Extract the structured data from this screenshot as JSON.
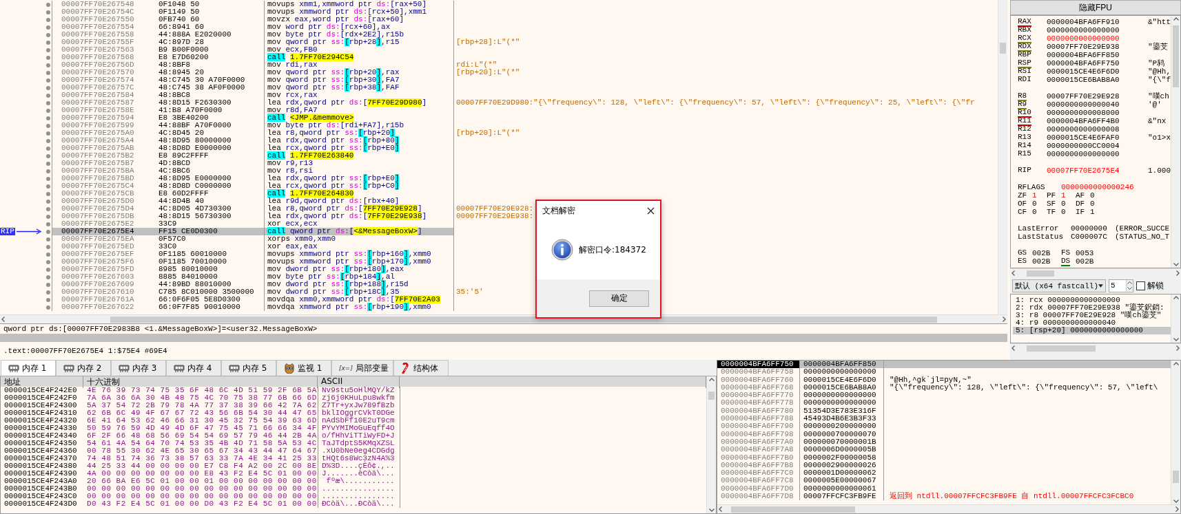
{
  "disassembly": {
    "rip_label": "RIP",
    "rows": [
      {
        "address": "00007FF70E267548",
        "bytes": "0F1048 50",
        "instruction": [
          {
            "text": "movups",
            "kind": "mnemonic"
          },
          {
            "text": " xmm1,xmmword ptr ",
            "kind": "operand"
          },
          {
            "text": "ds:",
            "kind": "segment"
          },
          {
            "text": "[rax+50]",
            "kind": "operand"
          }
        ],
        "current": false
      },
      {
        "address": "00007FF70E26754C",
        "bytes": "0F1149 50",
        "instruction": [
          {
            "text": "movups",
            "kind": "mnemonic"
          },
          {
            "text": " xmmword ptr ",
            "kind": "operand"
          },
          {
            "text": "ds:",
            "kind": "segment"
          },
          {
            "text": "[rcx+50],xmm1",
            "kind": "operand"
          }
        ],
        "current": false
      },
      {
        "address": "00007FF70E267550",
        "bytes": "0FB740 60",
        "instruction": [
          {
            "text": "movzx",
            "kind": "mnemonic"
          },
          {
            "text": " eax,word ptr ",
            "kind": "operand"
          },
          {
            "text": "ds:",
            "kind": "segment"
          },
          {
            "text": "[rax+60]",
            "kind": "operand"
          }
        ],
        "current": false
      },
      {
        "address": "00007FF70E267554",
        "bytes": "66:8941 60",
        "instruction": [
          {
            "text": "mov",
            "kind": "mnemonic"
          },
          {
            "text": " word ptr ",
            "kind": "operand"
          },
          {
            "text": "ds:",
            "kind": "segment"
          },
          {
            "text": "[rcx+60],ax",
            "kind": "operand"
          }
        ],
        "current": false
      },
      {
        "address": "00007FF70E267558",
        "bytes": "44:888A E2020000",
        "instruction": [
          {
            "text": "mov",
            "kind": "mnemonic"
          },
          {
            "text": " byte ptr ",
            "kind": "operand"
          },
          {
            "text": "ds:",
            "kind": "segment"
          },
          {
            "text": "[rdx+2E2],r15b",
            "kind": "operand"
          }
        ],
        "current": false
      },
      {
        "address": "00007FF70E26755F",
        "bytes": "4C:897D 28",
        "instruction": [
          {
            "text": "mov",
            "kind": "mnemonic"
          },
          {
            "text": " qword ptr ",
            "kind": "operand"
          },
          {
            "text": "ss:",
            "kind": "segment"
          },
          {
            "text": "[",
            "kind": "bracket"
          },
          {
            "text": "rbp+28",
            "kind": "operand"
          },
          {
            "text": "]",
            "kind": "bracket"
          },
          {
            "text": ",r15",
            "kind": "operand"
          }
        ],
        "comment": "[rbp+28]:L\"(*\"",
        "current": false
      },
      {
        "address": "00007FF70E267563",
        "bytes": "B9 B00F0000",
        "instruction": [
          {
            "text": "mov",
            "kind": "mnemonic"
          },
          {
            "text": " ecx,FB0",
            "kind": "operand"
          }
        ],
        "current": false
      },
      {
        "address": "00007FF70E267568",
        "bytes": "E8 E7D60200",
        "instruction": [
          {
            "text": "call",
            "kind": "call"
          },
          {
            "text": "1.7FF70E294C54",
            "kind": "target"
          }
        ],
        "current": false
      },
      {
        "address": "00007FF70E26756D",
        "bytes": "48:8BF8",
        "instruction": [
          {
            "text": "mov",
            "kind": "mnemonic"
          },
          {
            "text": " rdi,rax",
            "kind": "operand"
          }
        ],
        "comment": "rdi:L\"(*\"",
        "current": false
      },
      {
        "address": "00007FF70E267570",
        "bytes": "48:8945 20",
        "instruction": [
          {
            "text": "mov",
            "kind": "mnemonic"
          },
          {
            "text": " qword ptr ",
            "kind": "operand"
          },
          {
            "text": "ss:",
            "kind": "segment"
          },
          {
            "text": "[",
            "kind": "bracket"
          },
          {
            "text": "rbp+20",
            "kind": "operand"
          },
          {
            "text": "]",
            "kind": "bracket"
          },
          {
            "text": ",rax",
            "kind": "operand"
          }
        ],
        "comment": "[rbp+20]:L\"(*\"",
        "current": false
      },
      {
        "address": "00007FF70E267574",
        "bytes": "48:C745 30 A70F0000",
        "instruction": [
          {
            "text": "mov",
            "kind": "mnemonic"
          },
          {
            "text": " qword ptr ",
            "kind": "operand"
          },
          {
            "text": "ss:",
            "kind": "segment"
          },
          {
            "text": "[",
            "kind": "bracket"
          },
          {
            "text": "rbp+30",
            "kind": "operand"
          },
          {
            "text": "]",
            "kind": "bracket"
          },
          {
            "text": ",FA7",
            "kind": "operand"
          }
        ],
        "current": false
      },
      {
        "address": "00007FF70E26757C",
        "bytes": "48:C745 38 AF0F0000",
        "instruction": [
          {
            "text": "mov",
            "kind": "mnemonic"
          },
          {
            "text": " qword ptr ",
            "kind": "operand"
          },
          {
            "text": "ss:",
            "kind": "segment"
          },
          {
            "text": "[",
            "kind": "bracket"
          },
          {
            "text": "rbp+38",
            "kind": "operand"
          },
          {
            "text": "]",
            "kind": "bracket"
          },
          {
            "text": ",FAF",
            "kind": "operand"
          }
        ],
        "current": false
      },
      {
        "address": "00007FF70E267584",
        "bytes": "48:8BC8",
        "instruction": [
          {
            "text": "mov",
            "kind": "mnemonic"
          },
          {
            "text": " rcx,rax",
            "kind": "operand"
          }
        ],
        "current": false
      },
      {
        "address": "00007FF70E267587",
        "bytes": "48:8D15 F2630300",
        "instruction": [
          {
            "text": "lea",
            "kind": "mnemonic"
          },
          {
            "text": " rdx,qword ptr ",
            "kind": "operand"
          },
          {
            "text": "ds:",
            "kind": "segment"
          },
          {
            "text": "[",
            "kind": "operand"
          },
          {
            "text": "7FF70E29D980",
            "kind": "target"
          },
          {
            "text": "]",
            "kind": "operand"
          }
        ],
        "comment": "00007FF70E29D980:\"{\\\"frequency\\\": 128, \\\"left\\\": {\\\"frequency\\\": 57, \\\"left\\\": {\\\"frequency\\\": 25, \\\"left\\\": {\\\"fr",
        "current": false
      },
      {
        "address": "00007FF70E26758E",
        "bytes": "41:B8 A70F0000",
        "instruction": [
          {
            "text": "mov",
            "kind": "mnemonic"
          },
          {
            "text": " r8d,FA7",
            "kind": "operand"
          }
        ],
        "current": false
      },
      {
        "address": "00007FF70E267594",
        "bytes": "E8 3BE40200",
        "instruction": [
          {
            "text": "call",
            "kind": "call"
          },
          {
            "text": "<JMP.&memmove>",
            "kind": "target"
          }
        ],
        "current": false
      },
      {
        "address": "00007FF70E267599",
        "bytes": "44:88BF A70F0000",
        "instruction": [
          {
            "text": "mov",
            "kind": "mnemonic"
          },
          {
            "text": " byte ptr ",
            "kind": "operand"
          },
          {
            "text": "ds:",
            "kind": "segment"
          },
          {
            "text": "[rdi+FA7],r15b",
            "kind": "operand"
          }
        ],
        "current": false
      },
      {
        "address": "00007FF70E2675A0",
        "bytes": "4C:8D45 20",
        "instruction": [
          {
            "text": "lea",
            "kind": "mnemonic"
          },
          {
            "text": " r8,qword ptr ",
            "kind": "operand"
          },
          {
            "text": "ss:",
            "kind": "segment"
          },
          {
            "text": "[",
            "kind": "bracket"
          },
          {
            "text": "rbp+20",
            "kind": "operand"
          },
          {
            "text": "]",
            "kind": "bracket"
          }
        ],
        "comment": "[rbp+20]:L\"(*\"",
        "current": false
      },
      {
        "address": "00007FF70E2675A4",
        "bytes": "48:8D95 80000000",
        "instruction": [
          {
            "text": "lea",
            "kind": "mnemonic"
          },
          {
            "text": " rdx,qword ptr ",
            "kind": "operand"
          },
          {
            "text": "ss:",
            "kind": "segment"
          },
          {
            "text": "[",
            "kind": "bracket"
          },
          {
            "text": "rbp+80",
            "kind": "operand"
          },
          {
            "text": "]",
            "kind": "bracket"
          }
        ],
        "current": false
      },
      {
        "address": "00007FF70E2675AB",
        "bytes": "48:8D8D E0000000",
        "instruction": [
          {
            "text": "lea",
            "kind": "mnemonic"
          },
          {
            "text": " rcx,qword ptr ",
            "kind": "operand"
          },
          {
            "text": "ss:",
            "kind": "segment"
          },
          {
            "text": "[",
            "kind": "bracket"
          },
          {
            "text": "rbp+E0",
            "kind": "operand"
          },
          {
            "text": "]",
            "kind": "bracket"
          }
        ],
        "current": false
      },
      {
        "address": "00007FF70E2675B2",
        "bytes": "E8 89C2FFFF",
        "instruction": [
          {
            "text": "call",
            "kind": "call"
          },
          {
            "text": "1.7FF70E263840",
            "kind": "target"
          }
        ],
        "current": false
      },
      {
        "address": "00007FF70E2675B7",
        "bytes": "4D:8BCD",
        "instruction": [
          {
            "text": "mov",
            "kind": "mnemonic"
          },
          {
            "text": " r9,r13",
            "kind": "operand"
          }
        ],
        "current": false
      },
      {
        "address": "00007FF70E2675BA",
        "bytes": "4C:8BC6",
        "instruction": [
          {
            "text": "mov",
            "kind": "mnemonic"
          },
          {
            "text": " r8,rsi",
            "kind": "operand"
          }
        ],
        "current": false
      },
      {
        "address": "00007FF70E2675BD",
        "bytes": "48:8D95 E0000000",
        "instruction": [
          {
            "text": "lea",
            "kind": "mnemonic"
          },
          {
            "text": " rdx,qword ptr ",
            "kind": "operand"
          },
          {
            "text": "ss:",
            "kind": "segment"
          },
          {
            "text": "[",
            "kind": "bracket"
          },
          {
            "text": "rbp+E0",
            "kind": "operand"
          },
          {
            "text": "]",
            "kind": "bracket"
          }
        ],
        "current": false
      },
      {
        "address": "00007FF70E2675C4",
        "bytes": "48:8D8D C0000000",
        "instruction": [
          {
            "text": "lea",
            "kind": "mnemonic"
          },
          {
            "text": " rcx,qword ptr ",
            "kind": "operand"
          },
          {
            "text": "ss:",
            "kind": "segment"
          },
          {
            "text": "[",
            "kind": "bracket"
          },
          {
            "text": "rbp+C0",
            "kind": "operand"
          },
          {
            "text": "]",
            "kind": "bracket"
          }
        ],
        "current": false
      },
      {
        "address": "00007FF70E2675CB",
        "bytes": "E8 60D2FFFF",
        "instruction": [
          {
            "text": "call",
            "kind": "call"
          },
          {
            "text": "1.7FF70E264830",
            "kind": "target"
          }
        ],
        "current": false
      },
      {
        "address": "00007FF70E2675D0",
        "bytes": "44:8D4B 40",
        "instruction": [
          {
            "text": "lea",
            "kind": "mnemonic"
          },
          {
            "text": " r9d,qword ptr ",
            "kind": "operand"
          },
          {
            "text": "ds:",
            "kind": "segment"
          },
          {
            "text": "[rbx+40]",
            "kind": "operand"
          }
        ],
        "current": false
      },
      {
        "address": "00007FF70E2675D4",
        "bytes": "4C:8D05 4D730300",
        "instruction": [
          {
            "text": "lea",
            "kind": "mnemonic"
          },
          {
            "text": " r8,qword ptr ",
            "kind": "operand"
          },
          {
            "text": "ds:",
            "kind": "segment"
          },
          {
            "text": "[",
            "kind": "operand"
          },
          {
            "text": "7FF70E29E928",
            "kind": "target"
          },
          {
            "text": "]",
            "kind": "operand"
          }
        ],
        "comment": "00007FF70E29E928:",
        "current": false
      },
      {
        "address": "00007FF70E2675DB",
        "bytes": "48:8D15 56730300",
        "instruction": [
          {
            "text": "lea",
            "kind": "mnemonic"
          },
          {
            "text": " rdx,qword ptr ",
            "kind": "operand"
          },
          {
            "text": "ds:",
            "kind": "segment"
          },
          {
            "text": "[",
            "kind": "operand"
          },
          {
            "text": "7FF70E29E938",
            "kind": "target"
          },
          {
            "text": "]",
            "kind": "operand"
          }
        ],
        "comment": "00007FF70E29E938:",
        "current": false
      },
      {
        "address": "00007FF70E2675E2",
        "bytes": "33C9",
        "instruction": [
          {
            "text": "xor",
            "kind": "mnemonic"
          },
          {
            "text": " ecx,ecx",
            "kind": "operand"
          }
        ],
        "current": false
      },
      {
        "address": "00007FF70E2675E4",
        "bytes": "FF15 CE0D0300",
        "instruction": [
          {
            "text": "call",
            "kind": "call"
          },
          {
            "text": " qword ptr ",
            "kind": "operand"
          },
          {
            "text": "ds:",
            "kind": "segment"
          },
          {
            "text": "[",
            "kind": "operand"
          },
          {
            "text": "<&MessageBoxW>",
            "kind": "target"
          },
          {
            "text": "]",
            "kind": "operand"
          }
        ],
        "current": true
      },
      {
        "address": "00007FF70E2675EA",
        "bytes": "0F57C0",
        "instruction": [
          {
            "text": "xorps",
            "kind": "mnemonic"
          },
          {
            "text": " xmm0,xmm0",
            "kind": "operand"
          }
        ],
        "current": false
      },
      {
        "address": "00007FF70E2675ED",
        "bytes": "33C0",
        "instruction": [
          {
            "text": "xor",
            "kind": "mnemonic"
          },
          {
            "text": " eax,eax",
            "kind": "operand"
          }
        ],
        "current": false
      },
      {
        "address": "00007FF70E2675EF",
        "bytes": "0F1185 60010000",
        "instruction": [
          {
            "text": "movups",
            "kind": "mnemonic"
          },
          {
            "text": " xmmword ptr ",
            "kind": "operand"
          },
          {
            "text": "ss:",
            "kind": "segment"
          },
          {
            "text": "[",
            "kind": "bracket"
          },
          {
            "text": "rbp+160",
            "kind": "operand"
          },
          {
            "text": "]",
            "kind": "bracket"
          },
          {
            "text": ",xmm0",
            "kind": "operand"
          }
        ],
        "current": false
      },
      {
        "address": "00007FF70E2675F6",
        "bytes": "0F1185 70010000",
        "instruction": [
          {
            "text": "movups",
            "kind": "mnemonic"
          },
          {
            "text": " xmmword ptr ",
            "kind": "operand"
          },
          {
            "text": "ss:",
            "kind": "segment"
          },
          {
            "text": "[",
            "kind": "bracket"
          },
          {
            "text": "rbp+170",
            "kind": "operand"
          },
          {
            "text": "]",
            "kind": "bracket"
          },
          {
            "text": ",xmm0",
            "kind": "operand"
          }
        ],
        "current": false
      },
      {
        "address": "00007FF70E2675FD",
        "bytes": "8985 80010000",
        "instruction": [
          {
            "text": "mov",
            "kind": "mnemonic"
          },
          {
            "text": " dword ptr ",
            "kind": "operand"
          },
          {
            "text": "ss:",
            "kind": "segment"
          },
          {
            "text": "[",
            "kind": "bracket"
          },
          {
            "text": "rbp+180",
            "kind": "operand"
          },
          {
            "text": "]",
            "kind": "bracket"
          },
          {
            "text": ",eax",
            "kind": "operand"
          }
        ],
        "current": false
      },
      {
        "address": "00007FF70E267603",
        "bytes": "8885 84010000",
        "instruction": [
          {
            "text": "mov",
            "kind": "mnemonic"
          },
          {
            "text": " byte ptr ",
            "kind": "operand"
          },
          {
            "text": "ss:",
            "kind": "segment"
          },
          {
            "text": "[",
            "kind": "bracket"
          },
          {
            "text": "rbp+184",
            "kind": "operand"
          },
          {
            "text": "]",
            "kind": "bracket"
          },
          {
            "text": ",al",
            "kind": "operand"
          }
        ],
        "current": false
      },
      {
        "address": "00007FF70E267609",
        "bytes": "44:89BD 88010000",
        "instruction": [
          {
            "text": "mov",
            "kind": "mnemonic"
          },
          {
            "text": " dword ptr ",
            "kind": "operand"
          },
          {
            "text": "ss:",
            "kind": "segment"
          },
          {
            "text": "[",
            "kind": "bracket"
          },
          {
            "text": "rbp+188",
            "kind": "operand"
          },
          {
            "text": "]",
            "kind": "bracket"
          },
          {
            "text": ",r15d",
            "kind": "operand"
          }
        ],
        "current": false
      },
      {
        "address": "00007FF70E267610",
        "bytes": "C785 8C010000 3500000",
        "instruction": [
          {
            "text": "mov",
            "kind": "mnemonic"
          },
          {
            "text": " dword ptr ",
            "kind": "operand"
          },
          {
            "text": "ss:",
            "kind": "segment"
          },
          {
            "text": "[",
            "kind": "bracket"
          },
          {
            "text": "rbp+18C",
            "kind": "operand"
          },
          {
            "text": "]",
            "kind": "bracket"
          },
          {
            "text": ",35",
            "kind": "operand"
          }
        ],
        "comment": "35:'5'",
        "current": false
      },
      {
        "address": "00007FF70E26761A",
        "bytes": "66:0F6F05 5E8D0300",
        "instruction": [
          {
            "text": "movdqa",
            "kind": "mnemonic"
          },
          {
            "text": " xmm0,xmmword ptr ",
            "kind": "operand"
          },
          {
            "text": "ds:",
            "kind": "segment"
          },
          {
            "text": "[",
            "kind": "operand"
          },
          {
            "text": "7FF70E2A03",
            "kind": "target"
          }
        ],
        "current": false
      },
      {
        "address": "00007FF70E267622",
        "bytes": "66:0F7F85 90010000",
        "instruction": [
          {
            "text": "movdqa",
            "kind": "mnemonic"
          },
          {
            "text": " xmmword ptr ",
            "kind": "operand"
          },
          {
            "text": "ss:",
            "kind": "segment"
          },
          {
            "text": "[",
            "kind": "bracket"
          },
          {
            "text": "rbp+190",
            "kind": "operand"
          },
          {
            "text": "]",
            "kind": "bracket"
          },
          {
            "text": ",xmm0",
            "kind": "operand"
          }
        ],
        "current": false
      }
    ]
  },
  "info_line": "qword ptr ds:[00007FF70E2983B8 <1.&MessageBoxW>]=<user32.MessageBoxW>",
  "section_line": ".text:00007FF70E2675E4 1:$75E4 #69E4",
  "registers": {
    "hide_fpu_button": "隐藏FPU",
    "groups": [
      [
        {
          "name": "RAX",
          "value": "0000004BFA6FF910",
          "comment": "&\"htt",
          "modified": false,
          "color": "#c00000"
        },
        {
          "name": "RBX",
          "value": "0000000000000000",
          "modified": false
        },
        {
          "name": "RCX",
          "value": "0000000000000000",
          "modified": true,
          "color": "#808000"
        },
        {
          "name": "RDX",
          "value": "00007FF70E29E938",
          "comment": "\"鎏芠",
          "modified": false,
          "color": "#808000"
        },
        {
          "name": "RBP",
          "value": "0000004BFA6FF850",
          "modified": false
        },
        {
          "name": "RSP",
          "value": "0000004BFA6FF750",
          "comment": "\"P鸫",
          "modified": false,
          "color": "#808000"
        },
        {
          "name": "RSI",
          "value": "0000015CE4E6F6D0",
          "comment": "\"@Hh,",
          "modified": false
        },
        {
          "name": "RDI",
          "value": "0000015CE6BAB8A0",
          "comment": "\"{\\\"f",
          "modified": false
        }
      ],
      [
        {
          "name": "R8",
          "value": "00007FF70E29E928",
          "comment": "\"嘆ch",
          "modified": false,
          "color": "#808000"
        },
        {
          "name": "R9",
          "value": "0000000000000040",
          "comment": "'@'",
          "modified": false,
          "color": "#808000"
        },
        {
          "name": "R10",
          "value": "0000000000008000",
          "modified": false,
          "color": "#c00000"
        },
        {
          "name": "R11",
          "value": "0000004BFA6FF4B0",
          "comment": "&\"nx",
          "modified": false,
          "color": "#c00000"
        },
        {
          "name": "R12",
          "value": "0000000000000008",
          "modified": false
        },
        {
          "name": "R13",
          "value": "0000015CE4E6FAF0",
          "comment": "\"o1>x",
          "modified": false
        },
        {
          "name": "R14",
          "value": "0000000000CC0004",
          "modified": false
        },
        {
          "name": "R15",
          "value": "0000000000000000",
          "modified": false
        }
      ],
      [
        {
          "name": "RIP",
          "value": "00007FF70E2675E4",
          "comment": "1.000",
          "modified": true
        }
      ]
    ],
    "rflags": {
      "name": "RFLAGS",
      "value": "0000000000000246",
      "modified": true
    },
    "flags": [
      [
        {
          "name": "ZF",
          "value": "1",
          "modified": true
        },
        {
          "name": "PF",
          "value": "1",
          "modified": true
        },
        {
          "name": "AF",
          "value": "0",
          "modified": false
        }
      ],
      [
        {
          "name": "OF",
          "value": "0",
          "modified": false
        },
        {
          "name": "SF",
          "value": "0",
          "modified": false
        },
        {
          "name": "DF",
          "value": "0",
          "modified": false
        }
      ],
      [
        {
          "name": "CF",
          "value": "0",
          "modified": false
        },
        {
          "name": "TF",
          "value": "0",
          "modified": false
        },
        {
          "name": "IF",
          "value": "1",
          "modified": false
        }
      ]
    ],
    "status": [
      {
        "name": "LastError",
        "value": "00000000",
        "comment": "(ERROR_SUCCE"
      },
      {
        "name": "LastStatus",
        "value": "C000007C",
        "comment": "(STATUS_NO_T"
      }
    ],
    "segments": [
      [
        {
          "name": "GS",
          "value": "002B"
        },
        {
          "name": "FS",
          "value": "0053"
        }
      ],
      [
        {
          "name": "ES",
          "value": "002B"
        },
        {
          "name": "DS",
          "value": "002B",
          "color": "#008000"
        }
      ]
    ]
  },
  "call_convention": {
    "value": "默认 (x64 fastcall)",
    "count": "5",
    "lock": {
      "label": "解锁",
      "checked": false
    }
  },
  "arguments": [
    {
      "text": "1: rcx 0000000000000000",
      "selected": false
    },
    {
      "text": "2: rdx 00007FF70E29E938 \"鎏芠鈬銷:",
      "selected": false
    },
    {
      "text": "3: r8 00007FF70E29E928 \"嘆ch鎏芠\"",
      "selected": false
    },
    {
      "text": "4: r9 0000000000000040",
      "selected": false
    },
    {
      "text": "5: [rsp+20] 0000000000000000",
      "selected": true
    }
  ],
  "memory_tabs": [
    {
      "label": "内存 1",
      "kind": "memory",
      "selected": true
    },
    {
      "label": "内存 2",
      "kind": "memory",
      "selected": false
    },
    {
      "label": "内存 3",
      "kind": "memory",
      "selected": false
    },
    {
      "label": "内存 4",
      "kind": "memory",
      "selected": false
    },
    {
      "label": "内存 5",
      "kind": "memory",
      "selected": false
    },
    {
      "label": "监视 1",
      "kind": "watch",
      "selected": false
    },
    {
      "label": "局部变量",
      "kind": "locals",
      "icon_text": "[x=]",
      "selected": false
    },
    {
      "label": "结构体",
      "kind": "struct",
      "selected": false
    }
  ],
  "memory_dump": {
    "columns": [
      "地址",
      "十六进制",
      "ASCII"
    ],
    "rows": [
      {
        "address": "0000015CE4F242E0",
        "hex": "4E 76 39 73 74 75 35 6F 48 6C 4D 51 59 2F 6B 5A",
        "ascii": "Nv9stu5oHlMQY/kZ"
      },
      {
        "address": "0000015CE4F242F0",
        "hex": "7A 6A 36 6A 30 4B 48 75 4C 70 75 38 77 6B 66 6D",
        "ascii": "zj6j0KHuLpu8wkfm"
      },
      {
        "address": "0000015CE4F24300",
        "hex": "5A 37 54 72 2B 79 78 4A 77 37 38 39 66 42 7A 62",
        "ascii": "Z7Tr+yxJw789fBzb"
      },
      {
        "address": "0000015CE4F24310",
        "hex": "62 6B 6C 49 4F 67 67 72 43 56 6B 54 30 44 47 65",
        "ascii": "bklIOggrCVkT0DGe"
      },
      {
        "address": "0000015CE4F24320",
        "hex": "6E 41 64 53 62 46 66 31 30 45 32 75 54 39 63 6D",
        "ascii": "nAdSbFf10E2uT9cm"
      },
      {
        "address": "0000015CE4F24330",
        "hex": "50 59 76 59 4D 49 4D 6F 47 75 45 71 66 66 34 4F",
        "ascii": "PYvYMIMoGuEqff4O"
      },
      {
        "address": "0000015CE4F24340",
        "hex": "6F 2F 66 48 68 56 69 54 54 69 57 79 46 44 2B 4A",
        "ascii": "o/fHhViTTiWyFD+J"
      },
      {
        "address": "0000015CE4F24350",
        "hex": "54 61 4A 54 64 70 74 53 35 4B 4D 71 58 5A 53 4C",
        "ascii": "TaJTdptS5KMqXZSL"
      },
      {
        "address": "0000015CE4F24360",
        "hex": "00 78 55 30 62 4E 65 30 65 67 34 43 44 47 64 67",
        "ascii": ".xU0bNe0eg4CDGdg"
      },
      {
        "address": "0000015CE4F24370",
        "hex": "74 48 51 74 36 73 38 57 63 33 7A 4E 34 41 25 33",
        "ascii": "tHQt6s8Wc3zN4A%3"
      },
      {
        "address": "0000015CE4F24380",
        "hex": "44 25 33 44 00 00 00 00 E7 C8 F4 A2 00 2C 00 8E",
        "ascii": "D%3D....çÈô¢.,.."
      },
      {
        "address": "0000015CE4F24390",
        "hex": "4A 00 00 00 00 00 00 00 E8 43 F2 E4 5C 01 00 00",
        "ascii": "J.......èCòä\\..."
      },
      {
        "address": "0000015CE4F243A0",
        "hex": "20 66 BA E6 5C 01 00 00 01 00 00 00 00 00 00 00",
        "ascii": " fºæ\\..........."
      },
      {
        "address": "0000015CE4F243B0",
        "hex": "00 00 00 00 00 00 00 00 00 00 00 00 00 00 00 00",
        "ascii": "................"
      },
      {
        "address": "0000015CE4F243C0",
        "hex": "00 00 00 00 00 00 00 00 00 00 00 00 00 00 00 00",
        "ascii": "................"
      },
      {
        "address": "0000015CE4F243D0",
        "hex": "D0 43 F2 E4 5C 01 00 00 D0 43 F2 E4 5C 01 00 00",
        "ascii": "ÐCòä\\...ÐCòä\\..."
      }
    ]
  },
  "stack": {
    "rows": [
      {
        "address": "0000004BFA6FF750",
        "value": "0000004BFA6FF850",
        "kind": "plain",
        "selected": true
      },
      {
        "address": "0000004BFA6FF758",
        "value": "0000000000000000",
        "kind": "plain",
        "selected": false
      },
      {
        "address": "0000004BFA6FF760",
        "value": "0000015CE4E6F6D0",
        "comment": "\"@Hh,^gk`jl=pyN,~\"",
        "kind": "plain",
        "selected": false
      },
      {
        "address": "0000004BFA6FF768",
        "value": "0000015CE6BAB8A0",
        "comment": "\"{\\\"frequency\\\": 128, \\\"left\\\": {\\\"frequency\\\": 57, \\\"left\\",
        "kind": "plain",
        "selected": false
      },
      {
        "address": "0000004BFA6FF770",
        "value": "0000000000000000",
        "kind": "plain",
        "selected": false
      },
      {
        "address": "0000004BFA6FF778",
        "value": "0000000000000000",
        "kind": "plain",
        "selected": false
      },
      {
        "address": "0000004BFA6FF780",
        "value": "51354D3E783E316F",
        "kind": "plain",
        "selected": false
      },
      {
        "address": "0000004BFA6FF788",
        "value": "45493D4B6E3B3F33",
        "kind": "plain",
        "selected": false
      },
      {
        "address": "0000004BFA6FF790",
        "value": "0000000200000000",
        "kind": "plain",
        "selected": false
      },
      {
        "address": "0000004BFA6FF798",
        "value": "0000000700000070",
        "kind": "plain",
        "selected": false
      },
      {
        "address": "0000004BFA6FF7A0",
        "value": "000000070000001B",
        "kind": "plain",
        "selected": false
      },
      {
        "address": "0000004BFA6FF7A8",
        "value": "0000006D0000005B",
        "kind": "plain",
        "selected": false
      },
      {
        "address": "0000004BFA6FF7B0",
        "value": "0000002F00000058",
        "kind": "plain",
        "selected": false
      },
      {
        "address": "0000004BFA6FF7B8",
        "value": "0000002900000026",
        "kind": "plain",
        "selected": false
      },
      {
        "address": "0000004BFA6FF7C0",
        "value": "0000001D00000062",
        "kind": "plain",
        "selected": false
      },
      {
        "address": "0000004BFA6FF7C8",
        "value": "0000005E00000067",
        "kind": "plain",
        "selected": false
      },
      {
        "address": "0000004BFA6FF7D0",
        "value": "0000000000000061",
        "kind": "plain",
        "selected": false
      },
      {
        "address": "0000004BFA6FF7D8",
        "value": "00007FFCFC3FB9FE",
        "comment": "返回到 ntdll.00007FFCFC3FB9FE 自 ntdll.00007FFCFC3FCBC0",
        "kind": "return",
        "selected": false
      }
    ]
  },
  "dialog": {
    "title": "文档解密",
    "message": "解密口令:184372",
    "button": "确定"
  }
}
